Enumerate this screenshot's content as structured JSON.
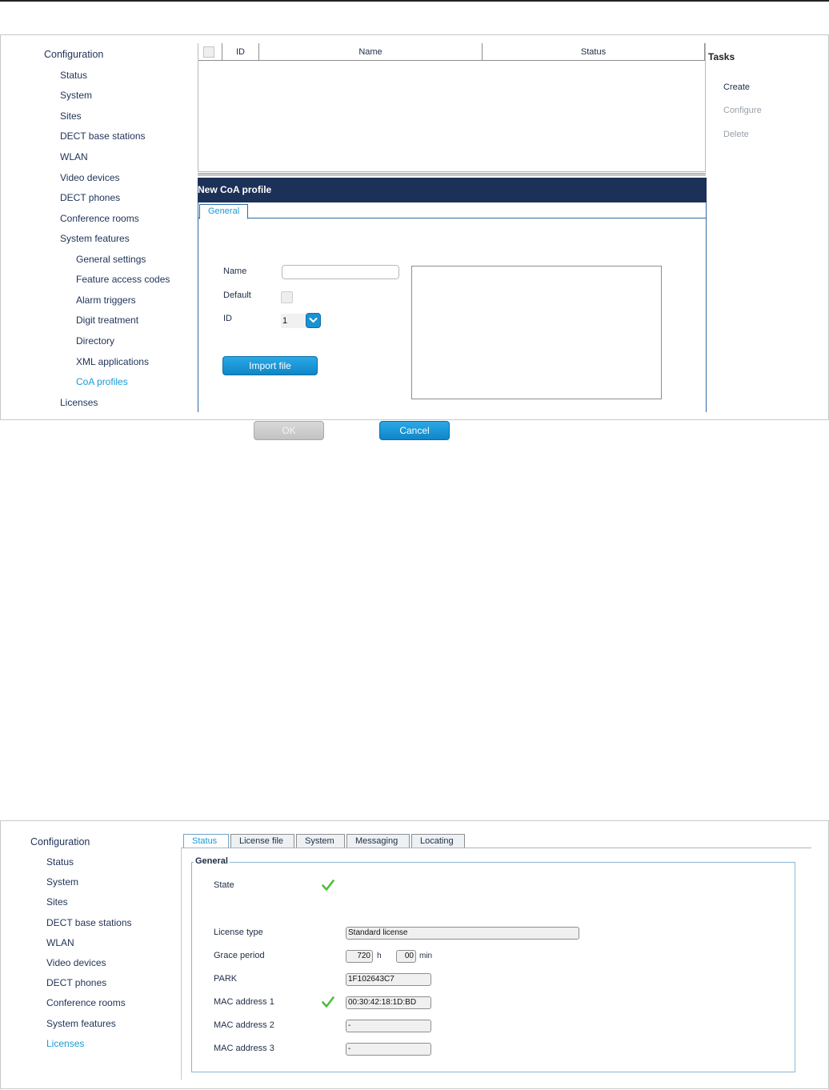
{
  "screen1": {
    "nav": {
      "configuration": "Configuration",
      "items": [
        "Status",
        "System",
        "Sites",
        "DECT base stations",
        "WLAN",
        "Video devices",
        "DECT phones",
        "Conference rooms",
        "System features"
      ],
      "sub_items": [
        "General settings",
        "Feature access codes",
        "Alarm triggers",
        "Digit treatment",
        "Directory",
        "XML applications",
        "CoA profiles"
      ],
      "licenses": "Licenses"
    },
    "table": {
      "columns": [
        "ID",
        "Name",
        "Status"
      ]
    },
    "tasks": {
      "title": "Tasks",
      "create": "Create",
      "configure": "Configure",
      "delete": "Delete"
    },
    "dialog": {
      "title": "New CoA profile",
      "tab": "General",
      "name_label": "Name",
      "name_value": "",
      "default_label": "Default",
      "id_label": "ID",
      "id_value": "1",
      "import_button": "Import file",
      "ok_button": "OK",
      "cancel_button": "Cancel"
    }
  },
  "screen2": {
    "nav": {
      "configuration": "Configuration",
      "items": [
        "Status",
        "System",
        "Sites",
        "DECT base stations",
        "WLAN",
        "Video devices",
        "DECT phones",
        "Conference rooms",
        "System features"
      ],
      "licenses": "Licenses"
    },
    "tabs": [
      "Status",
      "License file",
      "System",
      "Messaging",
      "Locating"
    ],
    "general": {
      "legend": "General",
      "state_label": "State",
      "license_type_label": "License type",
      "license_type_value": "Standard license",
      "grace_period_label": "Grace period",
      "grace_hours": "720",
      "grace_hours_unit": "h",
      "grace_minutes": "00",
      "grace_minutes_unit": "min",
      "park_label": "PARK",
      "park_value": "1F102643C7",
      "mac1_label": "MAC address 1",
      "mac1_value": "00:30:42:18:1D:BD",
      "mac2_label": "MAC address 2",
      "mac2_value": "-",
      "mac3_label": "MAC address 3",
      "mac3_value": "-"
    },
    "colors": {
      "accent": "#1a9ad6",
      "ok_green": "#4cbf3a",
      "dialog_header": "#1c3157"
    }
  }
}
